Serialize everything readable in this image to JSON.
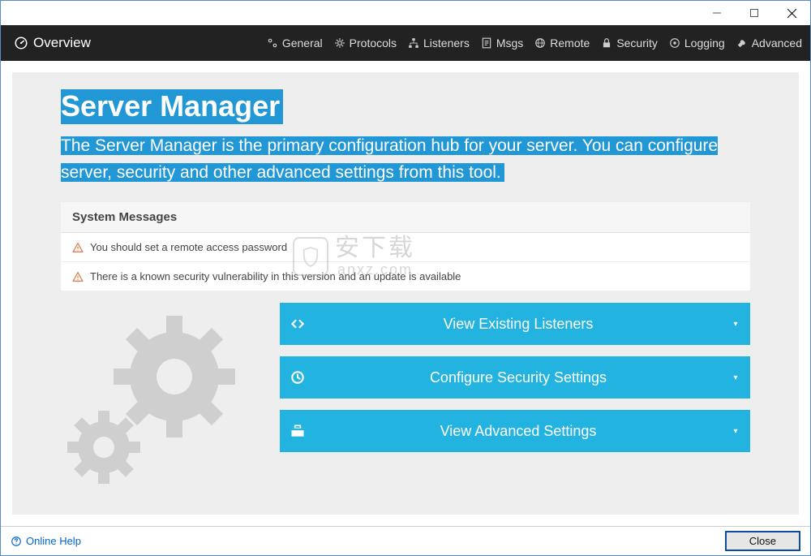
{
  "nav": {
    "title": "Overview",
    "items": [
      "General",
      "Protocols",
      "Listeners",
      "Msgs",
      "Remote",
      "Security",
      "Logging",
      "Advanced"
    ]
  },
  "page": {
    "title": "Server Manager",
    "description": "The Server Manager is the primary configuration hub for your server. You can configure server, security and other advanced settings from this tool."
  },
  "systemMessages": {
    "header": "System Messages",
    "items": [
      "You should set a remote access password",
      "There is a known security vulnerability in this version and an update is available"
    ]
  },
  "actions": {
    "listeners": "View Existing Listeners",
    "security": "Configure Security Settings",
    "advanced": "View Advanced Settings"
  },
  "footer": {
    "help": "Online Help",
    "close": "Close"
  },
  "watermark": {
    "cn": "安下载",
    "en": "anxz.com"
  }
}
